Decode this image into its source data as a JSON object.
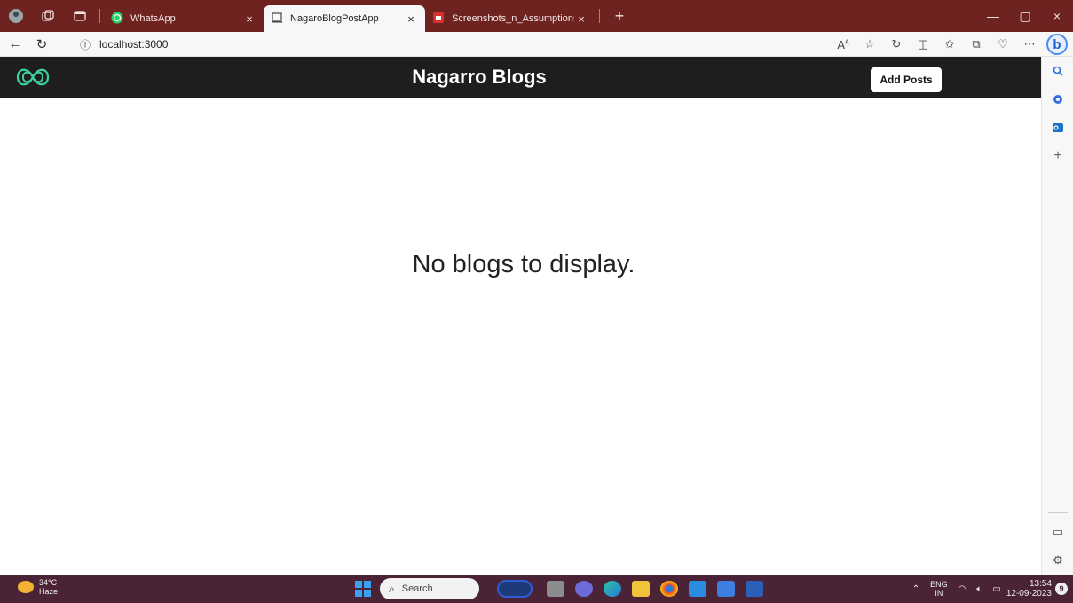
{
  "browser": {
    "tabs": [
      {
        "label": "WhatsApp",
        "close": "×"
      },
      {
        "label": "NagaroBlogPostApp",
        "close": "×"
      },
      {
        "label": "Screenshots_n_Assumptions.pdf",
        "close": "×"
      }
    ],
    "new_tab": "+",
    "window_controls": {
      "minimize": "—",
      "maximize": "▢",
      "close": "×"
    },
    "url": "localhost:3000",
    "nav": {
      "back": "←",
      "refresh": "↻",
      "info": "ⓘ"
    }
  },
  "app": {
    "brand": "Nagarro Blogs",
    "add_button": "Add Posts",
    "empty_message": "No blogs to display."
  },
  "taskbar": {
    "weather_temp": "34°C",
    "weather_desc": "Haze",
    "search_label": "Search",
    "language": "ENG",
    "region": "IN",
    "time": "13:54",
    "date": "12-09-2023",
    "notifications": "9"
  }
}
